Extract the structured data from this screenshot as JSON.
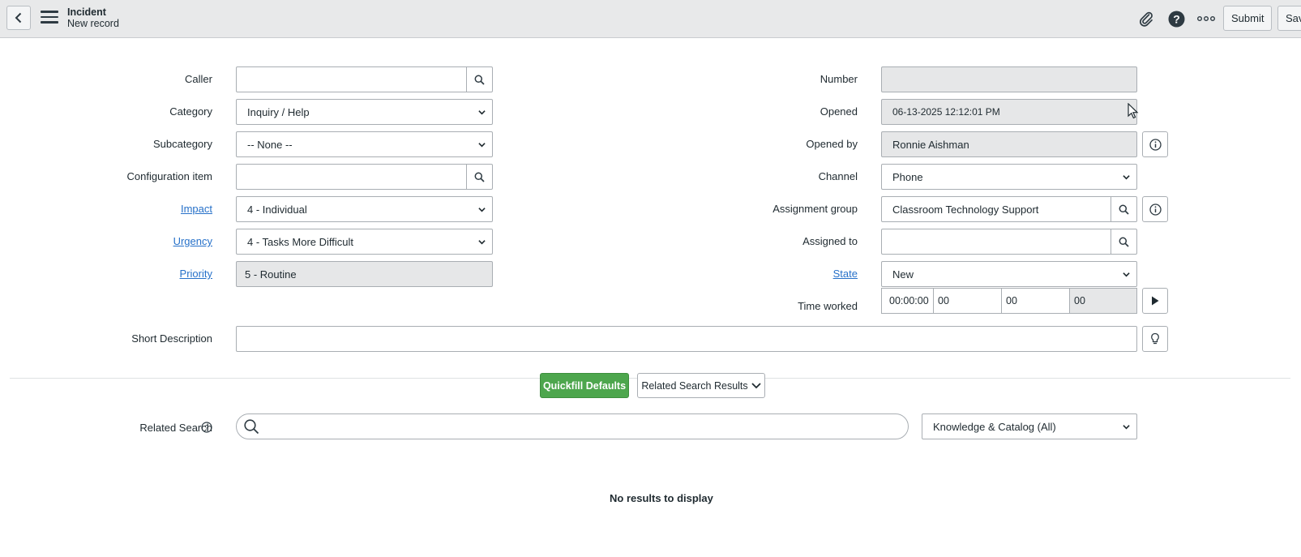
{
  "header": {
    "title": "Incident",
    "subtitle": "New record",
    "submit_label": "Submit",
    "save_label": "Sav"
  },
  "form": {
    "caller": {
      "label": "Caller",
      "value": ""
    },
    "category": {
      "label": "Category",
      "value": "Inquiry / Help"
    },
    "subcategory": {
      "label": "Subcategory",
      "value": "-- None --"
    },
    "configuration_item": {
      "label": "Configuration item",
      "value": ""
    },
    "impact": {
      "label": "Impact",
      "value": "4 - Individual"
    },
    "urgency": {
      "label": "Urgency",
      "value": "4 - Tasks More Difficult"
    },
    "priority": {
      "label": "Priority",
      "value": "5 - Routine"
    },
    "number": {
      "label": "Number",
      "value": ""
    },
    "opened": {
      "label": "Opened",
      "value": "06-13-2025 12:12:01 PM"
    },
    "opened_by": {
      "label": "Opened by",
      "value": "Ronnie Aishman"
    },
    "channel": {
      "label": "Channel",
      "value": "Phone"
    },
    "assignment_group": {
      "label": "Assignment group",
      "value": "Classroom Technology Support"
    },
    "assigned_to": {
      "label": "Assigned to",
      "value": ""
    },
    "state": {
      "label": "State",
      "value": "New"
    },
    "time_worked": {
      "label": "Time worked",
      "timer": "00:00:00",
      "hours": "00",
      "minutes": "00",
      "seconds": "00"
    },
    "short_description": {
      "label": "Short Description",
      "value": ""
    }
  },
  "actions": {
    "quickfill_label": "Quickfill Defaults",
    "related_results_label": "Related Search Results"
  },
  "related_search": {
    "label": "Related Search",
    "query": "",
    "scope": "Knowledge & Catalog (All)",
    "empty_message": "No results to display"
  },
  "colors": {
    "header_bg": "#e8e9ea",
    "link": "#2771c9",
    "quickfill_bg": "#4da64d",
    "readonly_bg": "#e6e7e8"
  }
}
